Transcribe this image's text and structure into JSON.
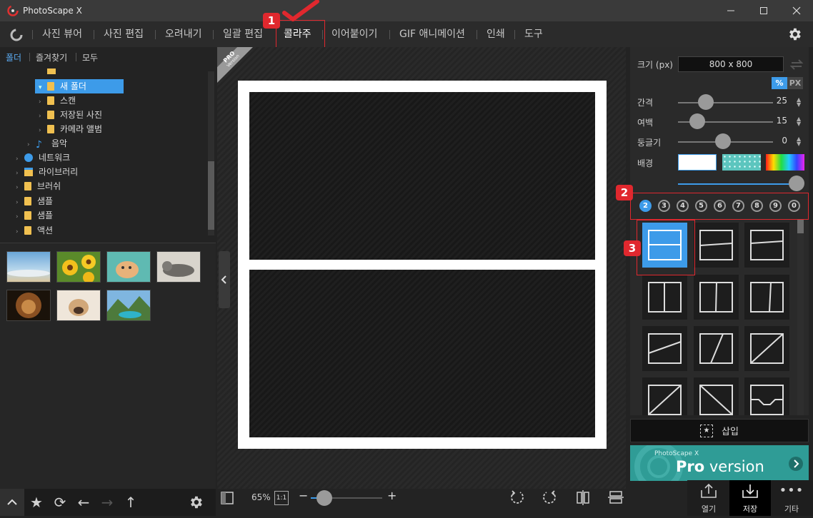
{
  "window": {
    "title": "PhotoScape X",
    "controls": [
      "minimize",
      "maximize",
      "close"
    ]
  },
  "menu": {
    "items": [
      "사진 뷰어",
      "사진 편집",
      "오려내기",
      "일괄 편집",
      "콜라주",
      "이어붙이기",
      "GIF 애니메이션",
      "인쇄",
      "도구"
    ],
    "active": "콜라주"
  },
  "left_tabs": [
    "폴더",
    "즐겨찾기",
    "모두"
  ],
  "tree": [
    {
      "label": "새 폴더",
      "selected": true
    },
    {
      "label": "스캔"
    },
    {
      "label": "저장된 사진"
    },
    {
      "label": "카메라 앨범"
    },
    {
      "label": "음악"
    },
    {
      "label": "네트워크"
    },
    {
      "label": "라이브러리"
    },
    {
      "label": "브러쉬"
    },
    {
      "label": "샘플"
    },
    {
      "label": "샘플"
    },
    {
      "label": "액션"
    }
  ],
  "pro_badge": {
    "line1": "PRO",
    "line2": "Version"
  },
  "canvas_bottom": {
    "zoom": "65%",
    "one_to_one": "1:1",
    "minus": "−",
    "plus": "+"
  },
  "right": {
    "size_label": "크기 (px)",
    "size_value": "800 x 800",
    "unit_percent": "%",
    "unit_px": "PX",
    "spacing_label": "간격",
    "spacing_value": "25",
    "margin_label": "여백",
    "margin_value": "15",
    "round_label": "둥글기",
    "round_value": "0",
    "background_label": "배경",
    "count_options": [
      "2",
      "3",
      "4",
      "5",
      "6",
      "7",
      "8",
      "9",
      "0"
    ],
    "count_selected": "2",
    "insert_label": "삽입",
    "pro_banner_small": "PhotoScape X",
    "pro_banner_big": "Pro",
    "pro_banner_rest": "version"
  },
  "right_bottom": {
    "open": "열기",
    "save": "저장",
    "more": "기타"
  },
  "callouts": [
    "1",
    "2",
    "3"
  ],
  "colors": {
    "accent": "#3d9be9",
    "callout_red": "#e0282e",
    "banner": "#2f9c96"
  }
}
